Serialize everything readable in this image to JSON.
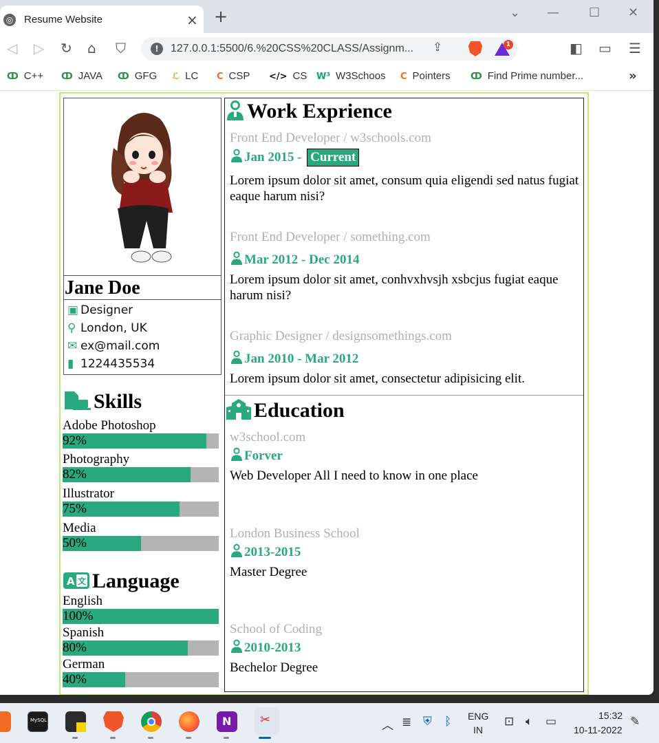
{
  "browser": {
    "tab_title": "Resume Website",
    "url": "127.0.0.1:5500/6.%20CSS%20CLASS/Assignm...",
    "shield_badge": "1",
    "bookmarks": [
      {
        "label": "C++",
        "icon": "gfg-icon"
      },
      {
        "label": "JAVA",
        "icon": "gfg-icon"
      },
      {
        "label": "GFG",
        "icon": "gfg-icon"
      },
      {
        "label": "LC",
        "icon": "leetcode-icon"
      },
      {
        "label": "CSP",
        "icon": "codestudio-icon"
      },
      {
        "label": "CS",
        "icon": "code-icon"
      },
      {
        "label": "W3Schoos",
        "icon": "w3-icon"
      },
      {
        "label": "Pointers",
        "icon": "codestudio-icon"
      },
      {
        "label": "Find Prime number...",
        "icon": "gfg-icon"
      }
    ],
    "more": "»"
  },
  "resume": {
    "accent": "#28a97f",
    "profile": {
      "name": "Jane Doe",
      "title": "Designer",
      "location": "London, UK",
      "email": "ex@mail.com",
      "phone": "1224435534"
    },
    "skills_heading": "Skills",
    "skills": [
      {
        "name": "Adobe Photoshop",
        "percent_label": "92%",
        "value": 0.92
      },
      {
        "name": "Photography",
        "percent_label": "82%",
        "value": 0.82
      },
      {
        "name": "Illustrator",
        "percent_label": "75%",
        "value": 0.75
      },
      {
        "name": "Media",
        "percent_label": "50%",
        "value": 0.5
      }
    ],
    "language_heading": "Language",
    "languages": [
      {
        "name": "English",
        "percent_label": "100%",
        "value": 1.0
      },
      {
        "name": "Spanish",
        "percent_label": "80%",
        "value": 0.8
      },
      {
        "name": "German",
        "percent_label": "40%",
        "value": 0.4
      }
    ],
    "work_heading": "Work Exprience",
    "work": [
      {
        "company": "Front End Developer / w3schools.com",
        "date": "Jan 2015 - ",
        "badge": "Current",
        "desc": "Lorem ipsum dolor sit amet, consum quia eligendi sed natus fugiat eaque harum nisi?"
      },
      {
        "company": "Front End Developer / something.com",
        "date": "Mar 2012 - Dec 2014",
        "desc": "Lorem ipsum dolor sit amet, conhvxhvsjh xsbcjus fugiat eaque harum nisi?"
      },
      {
        "company": "Graphic Designer / designsomethings.com",
        "date": "Jan 2010 - Mar 2012",
        "desc": "Lorem ipsum dolor sit amet, consectetur adipisicing elit."
      }
    ],
    "education_heading": "Education",
    "education": [
      {
        "school": "w3school.com",
        "date": "Forver",
        "desc": "Web Developer All I need to know in one place"
      },
      {
        "school": "London Business School",
        "date": "2013-2015",
        "desc": "Master Degree"
      },
      {
        "school": "School of Coding",
        "date": "2010-2013",
        "desc": "Bechelor Degree"
      }
    ]
  },
  "taskbar": {
    "lang_top": "ENG",
    "lang_bottom": "IN",
    "time": "15:32",
    "date": "10-11-2022",
    "mysql_label": "MySQL"
  }
}
